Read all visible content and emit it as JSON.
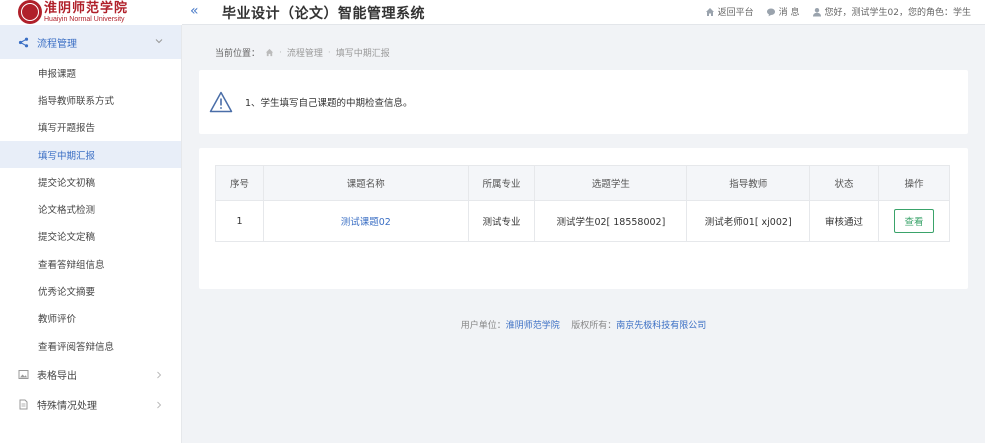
{
  "header": {
    "logo_cn": "淮阴师范学院",
    "logo_en": "Huaiyin Normal University",
    "collapse_icon": "«",
    "system_title": "毕业设计（论文）智能管理系统",
    "nav": {
      "back_platform": "返回平台",
      "messages": "消 息",
      "greeting": "您好，测试学生02，您的角色：学生"
    }
  },
  "sidebar": {
    "group_process": "流程管理",
    "items": [
      "申报课题",
      "指导教师联系方式",
      "填写开题报告",
      "填写中期汇报",
      "提交论文初稿",
      "论文格式检测",
      "提交论文定稿",
      "查看答辩组信息",
      "优秀论文摘要",
      "教师评价",
      "查看评阅答辩信息"
    ],
    "active_index": 3,
    "group_export": "表格导出",
    "group_special": "特殊情况处理"
  },
  "breadcrumb": {
    "prefix": "当前位置：",
    "level1": "流程管理",
    "level2": "填写中期汇报"
  },
  "notice": {
    "text": "1、学生填写自己课题的中期检查信息。"
  },
  "table": {
    "headers": [
      "序号",
      "课题名称",
      "所属专业",
      "选题学生",
      "指导教师",
      "状态",
      "操作"
    ],
    "rows": [
      {
        "index": "1",
        "topic": "测试课题02",
        "major": "测试专业",
        "student": "测试学生02[ 18558002]",
        "teacher": "测试老师01[ xj002]",
        "status": "审核通过",
        "action": "查看"
      }
    ]
  },
  "footer": {
    "unit_label": "用户单位：",
    "unit": "淮阴师范学院",
    "copyright_label": "版权所有：",
    "copyright": "南京先极科技有限公司"
  },
  "colors": {
    "accent": "#3b6fc4",
    "brand_red": "#b0202a",
    "success_green": "#3aa36a"
  }
}
